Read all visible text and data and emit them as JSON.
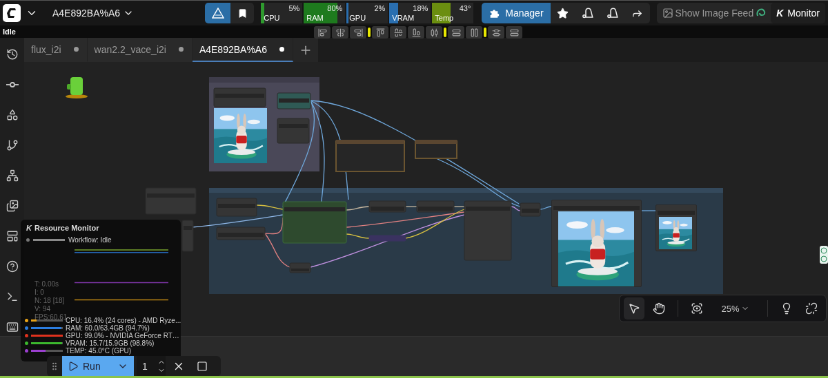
{
  "header": {
    "workflow_name": "A4E892BA%A6",
    "status": "Idle"
  },
  "meters": [
    {
      "label": "CPU",
      "reading": "5%",
      "level": 0.05,
      "color": "#2e9a2e"
    },
    {
      "label": "RAM",
      "reading": "80%",
      "level": 0.8,
      "color": "#1e7a1e"
    },
    {
      "label": "GPU",
      "reading": "2%",
      "level": 0.02,
      "color": "#2a6fb0"
    },
    {
      "label": "VRAM",
      "reading": "18%",
      "level": 0.18,
      "color": "#2a6fb0"
    },
    {
      "label": "Temp",
      "reading": "43°",
      "level": 0.43,
      "color": "#6b8e10"
    }
  ],
  "manager_button": "Manager",
  "image_feed_button": "Show Image Feed",
  "monitor_button": {
    "logo": "K",
    "label": "Monitor"
  },
  "tabs": [
    {
      "label": "flux_i2i",
      "selected": false,
      "unsaved": true
    },
    {
      "label": "wan2.2_vace_i2i",
      "selected": false,
      "unsaved": true
    },
    {
      "label": "A4E892BA%A6",
      "selected": true,
      "unsaved": true
    }
  ],
  "resource_monitor": {
    "logo": "K",
    "title": "Resource Monitor",
    "workflow_status": "Workflow: Idle",
    "workflow_progress": {
      "level": 1
    },
    "stats": [
      "T: 0.00s",
      "I: 0",
      "N: 18 [18]",
      "V: 94",
      "FPS:60.61"
    ],
    "resources": [
      {
        "text": "CPU: 16.4% (24 cores) - AMD Ryze...",
        "color": "#e8a317",
        "level": 0.164
      },
      {
        "text": "RAM: 60.0/63.4GB (94.7%)",
        "color": "#2b7de0",
        "level": 0.947
      },
      {
        "text": "GPU: 99.0% - NVIDIA GeForce RT…",
        "color": "#e0321e",
        "level": 0.99
      },
      {
        "text": "VRAM: 15.7/15.9GB (98.8%)",
        "color": "#3cb82e",
        "level": 0.988
      },
      {
        "text": "TEMP: 45.0°C (GPU)",
        "color": "#9b3fd0",
        "level": 0.45
      }
    ]
  },
  "run_bar": {
    "run_label": "Run",
    "batch_count": "1"
  },
  "canvas_controls": {
    "tools": [
      {
        "kind": "select",
        "selected": true
      },
      {
        "kind": "pan",
        "selected": false
      }
    ],
    "zoom": "25%"
  }
}
